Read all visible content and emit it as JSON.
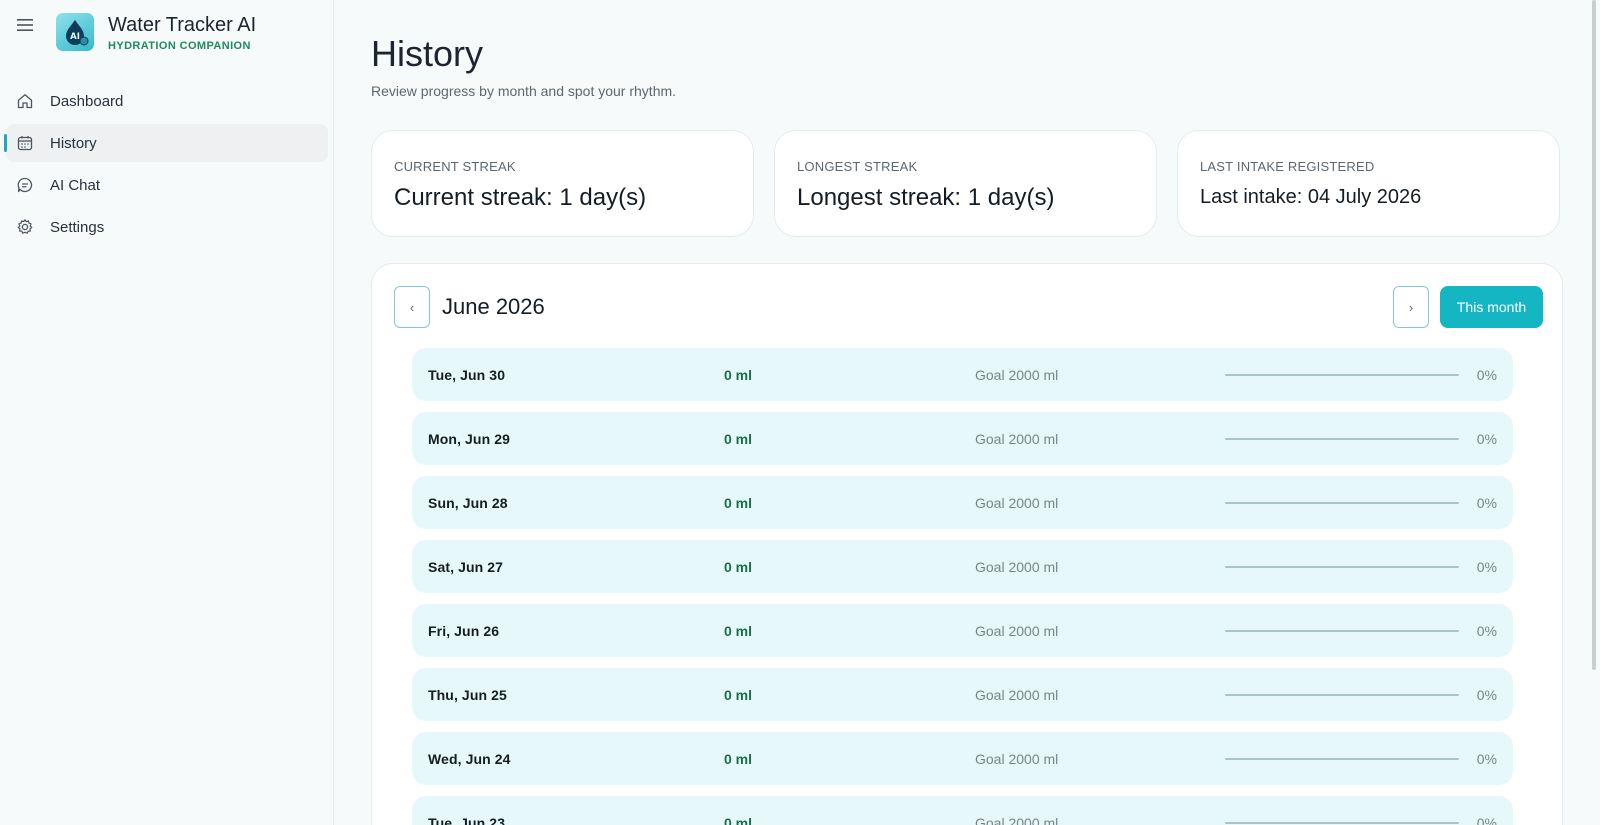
{
  "app": {
    "title": "Water Tracker AI",
    "subtitle": "HYDRATION COMPANION",
    "logo_text": "AI"
  },
  "sidebar": {
    "items": [
      {
        "label": "Dashboard",
        "icon": "home-icon",
        "active": false
      },
      {
        "label": "History",
        "icon": "calendar-icon",
        "active": true
      },
      {
        "label": "AI Chat",
        "icon": "chat-icon",
        "active": false
      },
      {
        "label": "Settings",
        "icon": "gear-icon",
        "active": false
      }
    ]
  },
  "page": {
    "title": "History",
    "subtitle": "Review progress by month and spot your rhythm."
  },
  "stats": {
    "current": {
      "caption": "CURRENT STREAK",
      "value": "Current streak: 1 day(s)"
    },
    "longest": {
      "caption": "LONGEST STREAK",
      "value": "Longest streak: 1 day(s)"
    },
    "last": {
      "caption": "LAST INTAKE REGISTERED",
      "value": "Last intake: 04 July 2026"
    }
  },
  "calendar": {
    "month": "June 2026",
    "prev_label": "‹",
    "next_label": "›",
    "this_month_label": "This month",
    "days": [
      {
        "date": "Tue, Jun 30",
        "amount": "0 ml",
        "goal": "Goal 2000 ml",
        "percent": "0%",
        "progress": 0
      },
      {
        "date": "Mon, Jun 29",
        "amount": "0 ml",
        "goal": "Goal 2000 ml",
        "percent": "0%",
        "progress": 0
      },
      {
        "date": "Sun, Jun 28",
        "amount": "0 ml",
        "goal": "Goal 2000 ml",
        "percent": "0%",
        "progress": 0
      },
      {
        "date": "Sat, Jun 27",
        "amount": "0 ml",
        "goal": "Goal 2000 ml",
        "percent": "0%",
        "progress": 0
      },
      {
        "date": "Fri, Jun 26",
        "amount": "0 ml",
        "goal": "Goal 2000 ml",
        "percent": "0%",
        "progress": 0
      },
      {
        "date": "Thu, Jun 25",
        "amount": "0 ml",
        "goal": "Goal 2000 ml",
        "percent": "0%",
        "progress": 0
      },
      {
        "date": "Wed, Jun 24",
        "amount": "0 ml",
        "goal": "Goal 2000 ml",
        "percent": "0%",
        "progress": 0
      },
      {
        "date": "Tue, Jun 23",
        "amount": "0 ml",
        "goal": "Goal 2000 ml",
        "percent": "0%",
        "progress": 0
      }
    ]
  },
  "colors": {
    "accent": "#14b6c4",
    "amount_text": "#196e4a",
    "row_bg": "#e6f8fa"
  }
}
